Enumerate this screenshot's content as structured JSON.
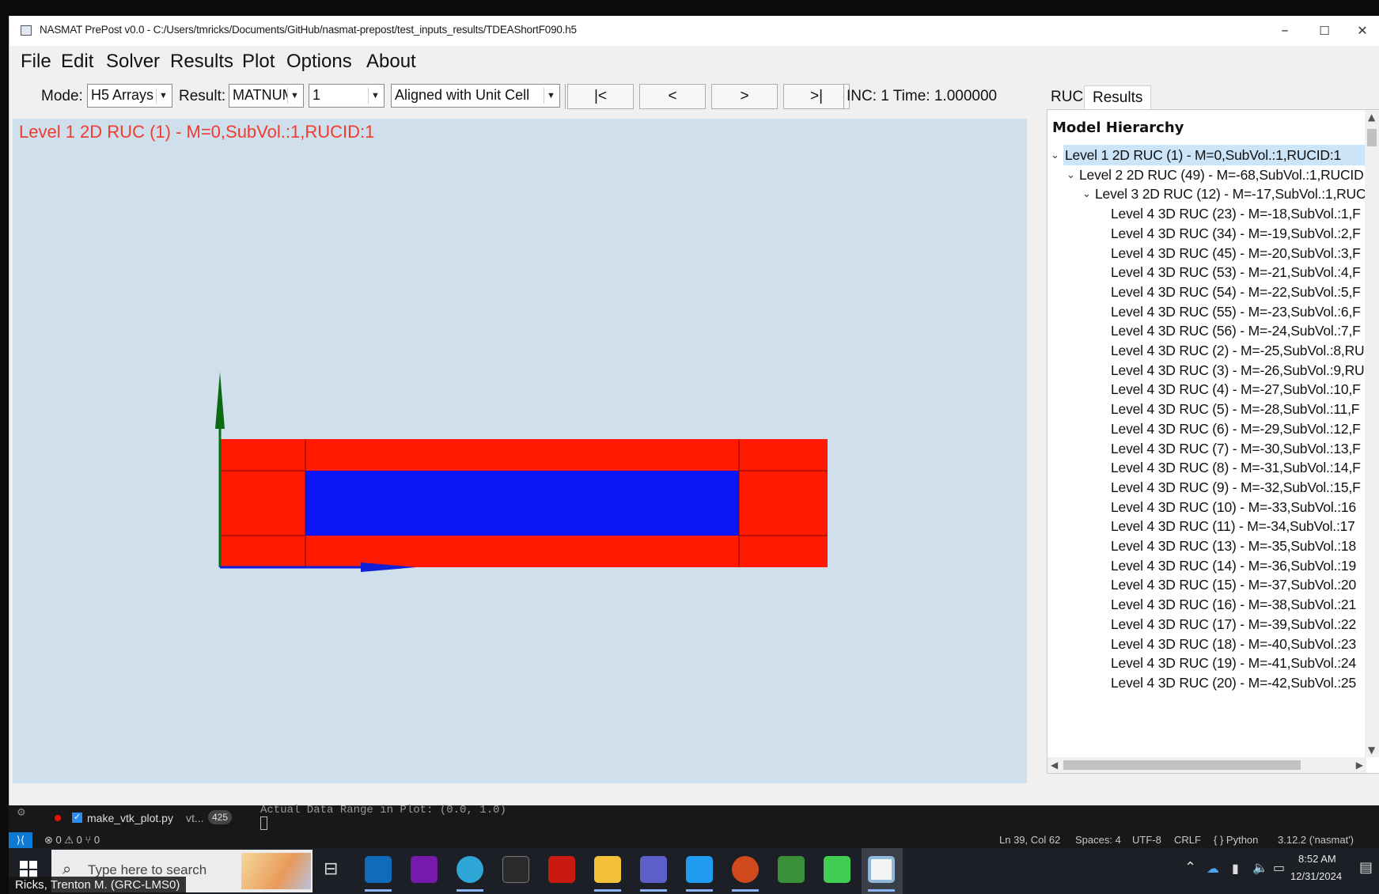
{
  "window": {
    "title": "NASMAT PrePost v0.0 - C:/Users/tmricks/Documents/GitHub/nasmat-prepost/test_inputs_results/TDEAShortF090.h5",
    "minimize": "–",
    "maximize": "☐",
    "close": "✕"
  },
  "menu": [
    "File",
    "Edit",
    "Solver",
    "Results",
    "Plot",
    "Options",
    "About"
  ],
  "toolbar": {
    "mode_label": "Mode:",
    "mode_value": "H5 Arrays",
    "result_label": "Result:",
    "result_value": "MATNUM",
    "index_value": "1",
    "orientation_value": "Aligned with Unit Cell",
    "first_label": "|<",
    "prev_label": "<",
    "next_label": ">",
    "last_label": ">|",
    "inc_text": "INC: 1  Time: 1.000000"
  },
  "viewport": {
    "title": "Level 1 2D RUC (1) - M=0,SubVol.:1,RUCID:1",
    "colors": {
      "background": "#cfe0ec",
      "matrix": "#ff1a00",
      "fiber": "#0a16f5",
      "y_axis": "#0a6b12",
      "x_axis": "#1020d8"
    }
  },
  "panel": {
    "tabs": [
      "RUC",
      "Results"
    ],
    "active_tab": "Results",
    "tree_header": "Model Hierarchy",
    "nodes": [
      {
        "text": "Level 1 2D RUC (1) - M=0,SubVol.:1,RUCID:1",
        "depth": 0,
        "expanded": true,
        "selected": true
      },
      {
        "text": "Level 2 2D RUC (49) - M=-68,SubVol.:1,RUCID",
        "depth": 1,
        "expanded": true
      },
      {
        "text": "Level 3 2D RUC (12) - M=-17,SubVol.:1,RUC",
        "depth": 2,
        "expanded": true
      },
      {
        "text": "Level 4 3D RUC (23) - M=-18,SubVol.:1,F",
        "depth": 3
      },
      {
        "text": "Level 4 3D RUC (34) - M=-19,SubVol.:2,F",
        "depth": 3
      },
      {
        "text": "Level 4 3D RUC (45) - M=-20,SubVol.:3,F",
        "depth": 3
      },
      {
        "text": "Level 4 3D RUC (53) - M=-21,SubVol.:4,F",
        "depth": 3
      },
      {
        "text": "Level 4 3D RUC (54) - M=-22,SubVol.:5,F",
        "depth": 3
      },
      {
        "text": "Level 4 3D RUC (55) - M=-23,SubVol.:6,F",
        "depth": 3
      },
      {
        "text": "Level 4 3D RUC (56) - M=-24,SubVol.:7,F",
        "depth": 3
      },
      {
        "text": "Level 4 3D RUC (2) - M=-25,SubVol.:8,RU",
        "depth": 3
      },
      {
        "text": "Level 4 3D RUC (3) - M=-26,SubVol.:9,RU",
        "depth": 3
      },
      {
        "text": "Level 4 3D RUC (4) - M=-27,SubVol.:10,F",
        "depth": 3
      },
      {
        "text": "Level 4 3D RUC (5) - M=-28,SubVol.:11,F",
        "depth": 3
      },
      {
        "text": "Level 4 3D RUC (6) - M=-29,SubVol.:12,F",
        "depth": 3
      },
      {
        "text": "Level 4 3D RUC (7) - M=-30,SubVol.:13,F",
        "depth": 3
      },
      {
        "text": "Level 4 3D RUC (8) - M=-31,SubVol.:14,F",
        "depth": 3
      },
      {
        "text": "Level 4 3D RUC (9) - M=-32,SubVol.:15,F",
        "depth": 3
      },
      {
        "text": "Level 4 3D RUC (10) - M=-33,SubVol.:16",
        "depth": 3
      },
      {
        "text": "Level 4 3D RUC (11) - M=-34,SubVol.:17",
        "depth": 3
      },
      {
        "text": "Level 4 3D RUC (13) - M=-35,SubVol.:18",
        "depth": 3
      },
      {
        "text": "Level 4 3D RUC (14) - M=-36,SubVol.:19",
        "depth": 3
      },
      {
        "text": "Level 4 3D RUC (15) - M=-37,SubVol.:20",
        "depth": 3
      },
      {
        "text": "Level 4 3D RUC (16) - M=-38,SubVol.:21",
        "depth": 3
      },
      {
        "text": "Level 4 3D RUC (17) - M=-39,SubVol.:22",
        "depth": 3
      },
      {
        "text": "Level 4 3D RUC (18) - M=-40,SubVol.:23",
        "depth": 3
      },
      {
        "text": "Level 4 3D RUC (19) - M=-41,SubVol.:24",
        "depth": 3
      },
      {
        "text": "Level 4 3D RUC (20) - M=-42,SubVol.:25",
        "depth": 3
      }
    ]
  },
  "vscode": {
    "file_name": "make_vtk_plot.py",
    "file_suffix": "vt...",
    "badge": "425",
    "terminal_line": "Actual Data Range in Plot:  (0.0, 1.0)",
    "status_left": "⊗ 0 ⚠ 0   ⑂ 0",
    "status_right": [
      "Ln 39, Col 62",
      "Spaces: 4",
      "UTF-8",
      "CRLF",
      "{ } Python",
      "3.12.2 ('nasmat')"
    ]
  },
  "taskbar": {
    "search_placeholder": "Type here to search",
    "time": "8:52 AM",
    "date": "12/31/2024",
    "caption": "Ricks, Trenton M. (GRC-LMS0)"
  }
}
